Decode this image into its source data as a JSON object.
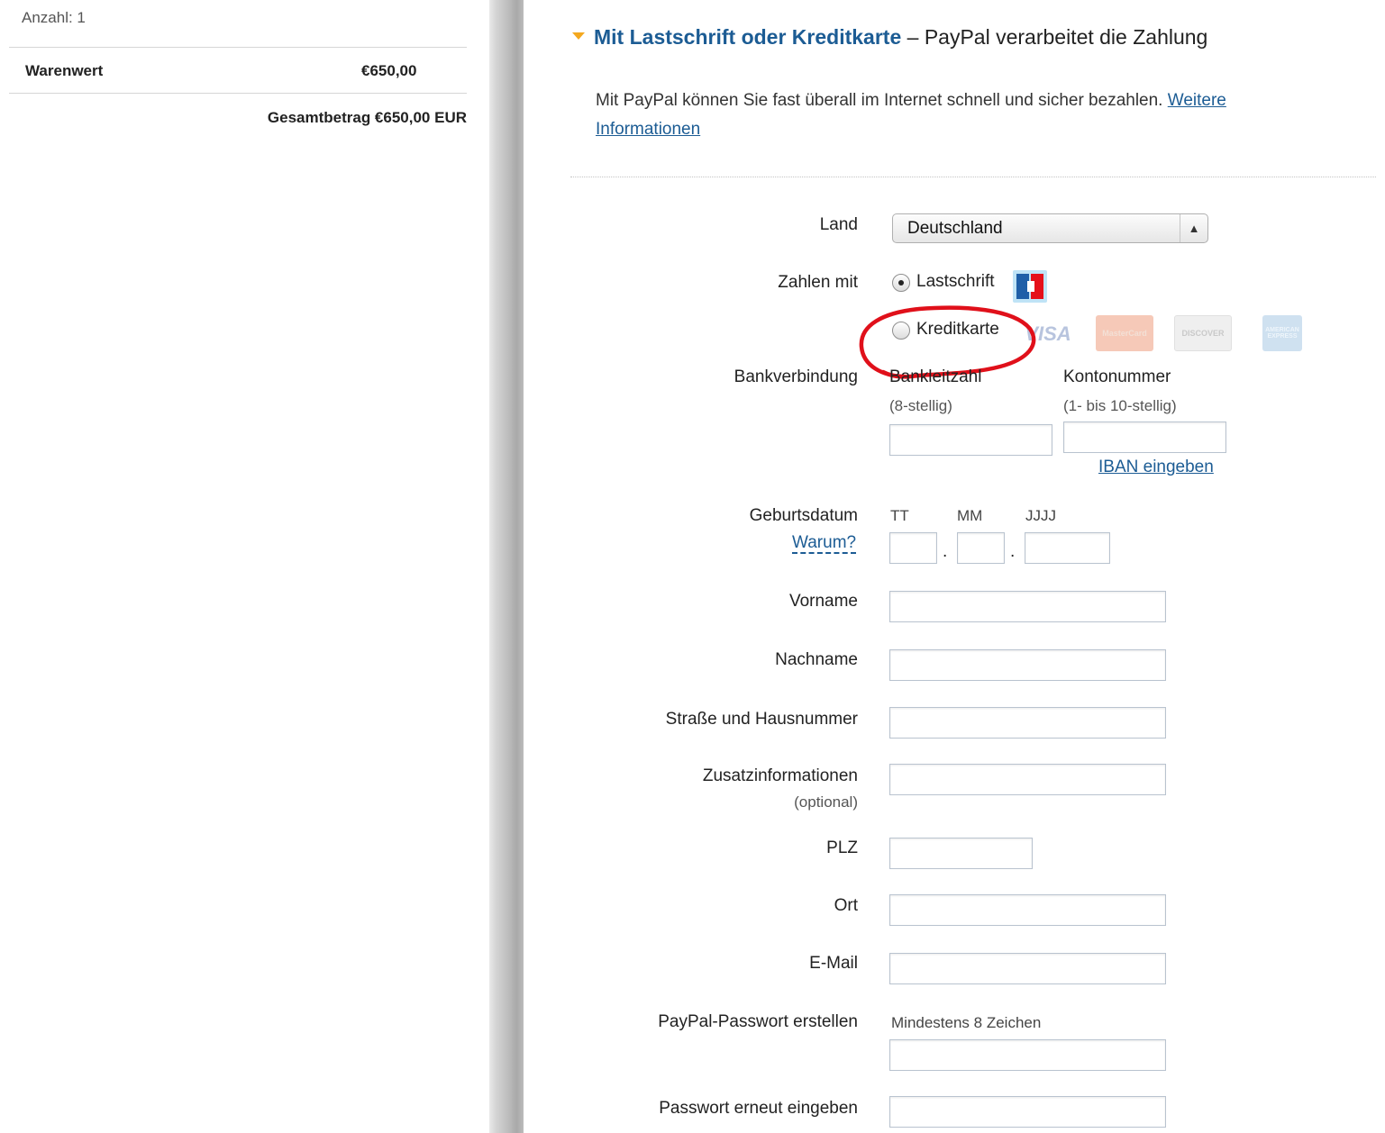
{
  "summary": {
    "quantity": "Anzahl: 1",
    "goods_label": "Warenwert",
    "goods_value": "€650,00",
    "total": "Gesamtbetrag €650,00 EUR"
  },
  "payment": {
    "heading_bold": "Mit Lastschrift oder Kreditkarte",
    "heading_rest": "– PayPal verarbeitet die Zahlung",
    "intro_text": "Mit PayPal können Sie fast überall im Internet schnell und sicher bezahlen.",
    "intro_link": "Weitere Informationen"
  },
  "form": {
    "country_label": "Land",
    "country_value": "Deutschland",
    "pay_with_label": "Zahlen mit",
    "option_debit": "Lastschrift",
    "option_credit": "Kreditkarte",
    "bank_label": "Bankverbindung",
    "blz_label": "Bankleitzahl",
    "blz_hint": "(8-stellig)",
    "account_label": "Kontonummer",
    "account_hint": "(1- bis 10-stellig)",
    "iban_link": "IBAN eingeben",
    "birthdate_label": "Geburtsdatum",
    "why_link": "Warum?",
    "day_label": "TT",
    "month_label": "MM",
    "year_label": "JJJJ",
    "firstname_label": "Vorname",
    "lastname_label": "Nachname",
    "street_label": "Straße und Hausnummer",
    "extra_label": "Zusatzinformationen",
    "extra_hint": "(optional)",
    "zip_label": "PLZ",
    "city_label": "Ort",
    "email_label": "E-Mail",
    "password_label": "PayPal-Passwort erstellen",
    "password_hint": "Mindestens 8 Zeichen",
    "password_repeat_label": "Passwort erneut eingeben"
  },
  "cards": {
    "visa": "VISA",
    "mastercard": "MasterCard",
    "discover": "DISCOVER",
    "amex": "AMERICAN EXPRESS"
  },
  "colors": {
    "link_blue": "#1c5c94",
    "caret_orange": "#f4a81f",
    "annotation_red": "#e0101a"
  }
}
